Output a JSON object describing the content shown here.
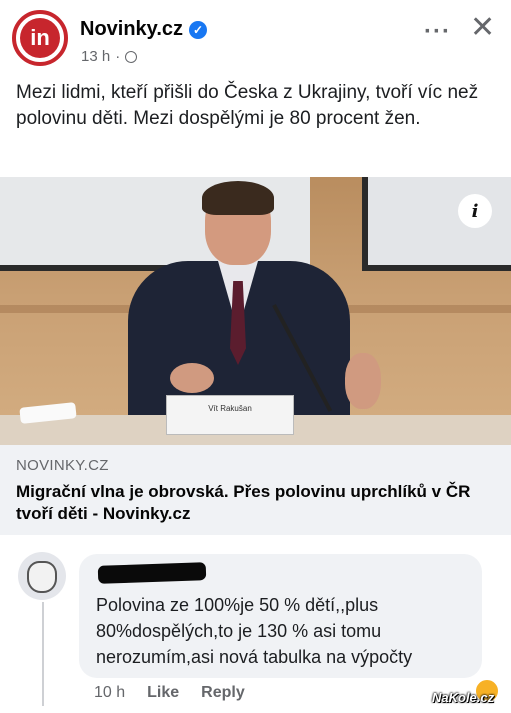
{
  "post": {
    "page_name": "Novinky.cz",
    "avatar_letters": "in",
    "time": "13 h",
    "separator": "·",
    "text": "Mezi lidmi, kteří přišli do Česka z Ukrajiny, tvoří víc než polovinu děti. Mezi dospělými je 80 procent žen.",
    "more_icon": "···",
    "close_icon": "✕"
  },
  "image": {
    "nameplate": "Vít Rakušan",
    "info_icon": "i"
  },
  "link": {
    "domain": "NOVINKY.CZ",
    "title": "Migrační vlna je obrovská. Přes polovinu uprchlíků v ČR tvoří děti - Novinky.cz"
  },
  "comment": {
    "text": "Polovina ze 100%je 50 % dětí,,plus 80%dospělých,to je 130 %  asi tomu nerozumím,asi nová tabulka na výpočty",
    "time": "10 h",
    "like": "Like",
    "reply": "Reply"
  },
  "watermark": "NaKole.cz",
  "colors": {
    "brand_red": "#c7262d",
    "verified_blue": "#1877f2",
    "bubble_bg": "#f0f2f5"
  }
}
